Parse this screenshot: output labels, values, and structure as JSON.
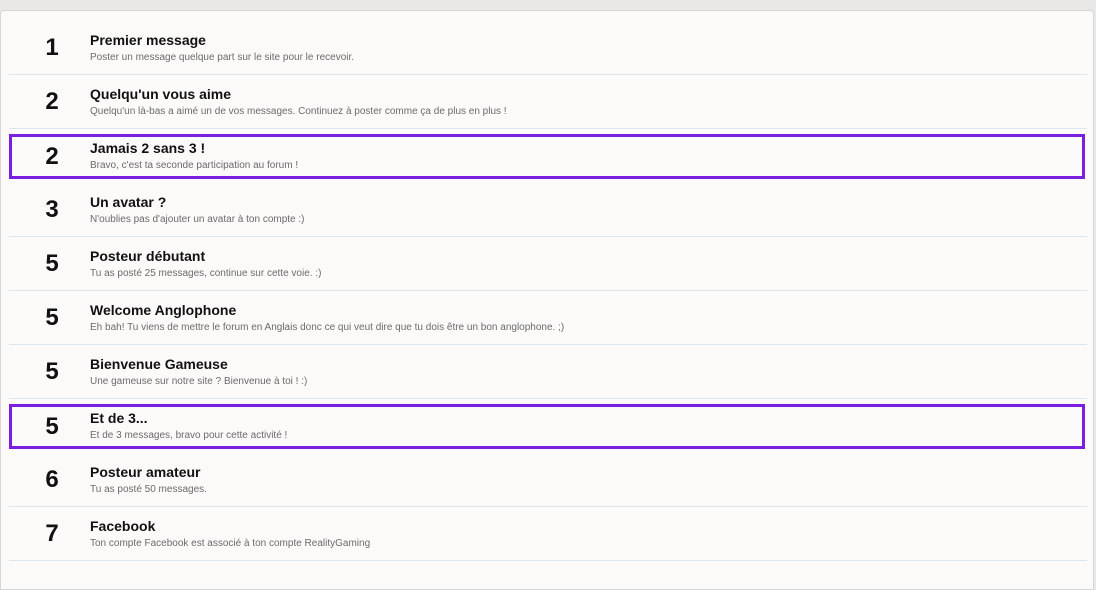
{
  "trophies": [
    {
      "points": "1",
      "title": "Premier message",
      "description": "Poster un message quelque part sur le site pour le recevoir."
    },
    {
      "points": "2",
      "title": "Quelqu'un vous aime",
      "description": "Quelqu'un là-bas a aimé un de vos messages. Continuez à poster comme ça de plus en plus !"
    },
    {
      "points": "2",
      "title": "Jamais 2 sans 3 !",
      "description": "Bravo, c'est ta seconde participation au forum !"
    },
    {
      "points": "3",
      "title": "Un avatar ?",
      "description": "N'oublies pas d'ajouter un avatar à ton compte :)"
    },
    {
      "points": "5",
      "title": "Posteur débutant",
      "description": "Tu as posté 25 messages, continue sur cette voie. :)"
    },
    {
      "points": "5",
      "title": "Welcome Anglophone",
      "description": "Eh bah! Tu viens de mettre le forum en Anglais donc ce qui veut dire que tu dois être un bon anglophone. ;)"
    },
    {
      "points": "5",
      "title": "Bienvenue Gameuse",
      "description": "Une gameuse sur notre site ? Bienvenue à toi ! :)"
    },
    {
      "points": "5",
      "title": "Et de 3...",
      "description": "Et de 3 messages, bravo pour cette activité !"
    },
    {
      "points": "6",
      "title": "Posteur amateur",
      "description": "Tu as posté 50 messages."
    },
    {
      "points": "7",
      "title": "Facebook",
      "description": "Ton compte Facebook est associé à ton compte RealityGaming"
    }
  ],
  "highlight_color": "#7a1fe0"
}
